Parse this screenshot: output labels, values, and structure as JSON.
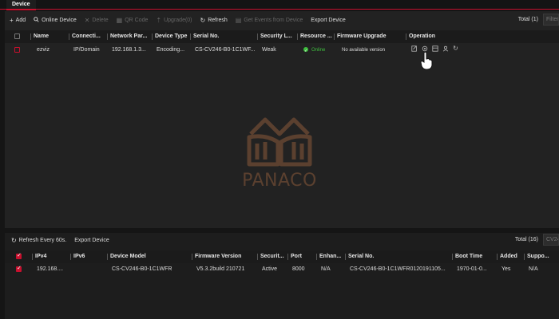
{
  "tab": {
    "label": "Device"
  },
  "toolbar": {
    "add": "Add",
    "online_device": "Online Device",
    "delete": "Delete",
    "qr_code": "QR Code",
    "upgrade": "Upgrade(0)",
    "refresh": "Refresh",
    "get_events": "Get Events from Device",
    "export": "Export Device",
    "total": "Total (1)",
    "filter_placeholder": "Filter"
  },
  "device_table": {
    "headers": [
      "Name",
      "Connecti...",
      "Network Par...",
      "Device Type",
      "Serial No.",
      "Security L...",
      "Resource ...",
      "Firmware Upgrade",
      "Operation"
    ],
    "rows": [
      {
        "name": "ezviz",
        "connection": "IP/Domain",
        "network": "192.168.1.3...",
        "device_type": "Encoding...",
        "serial": "CS-CV246-B0-1C1WF...",
        "security": "Weak",
        "resource": "Online",
        "firmware": "No available version"
      }
    ]
  },
  "watermark": {
    "text": "PANACO"
  },
  "online_toolbar": {
    "refresh": "Refresh Every 60s.",
    "export": "Export Device",
    "total": "Total (16)",
    "filter_placeholder": "CV24"
  },
  "online_table": {
    "headers": [
      "IPv4",
      "IPv6",
      "Device Model",
      "Firmware Version",
      "Securit...",
      "Port",
      "Enhan...",
      "Serial No.",
      "Boot Time",
      "Added",
      "Suppo..."
    ],
    "rows": [
      {
        "ipv4": "192.168....",
        "ipv6": "",
        "model": "CS-CV246-B0-1C1WFR",
        "firmware": "V5.3.2build 210721",
        "security": "Active",
        "port": "8000",
        "enhanced": "N/A",
        "serial": "CS-CV246-B0-1C1WFR0120191105...",
        "boot_time": "1970-01-0...",
        "added": "Yes",
        "support": "N/A"
      }
    ]
  },
  "colors": {
    "accent": "#c8102e",
    "online": "#3fbf3f",
    "watermark": "#8a5a3a"
  },
  "icons": {
    "operation": [
      "edit-icon",
      "settings-icon",
      "remote-config-icon",
      "user-icon",
      "refresh-icon"
    ]
  }
}
